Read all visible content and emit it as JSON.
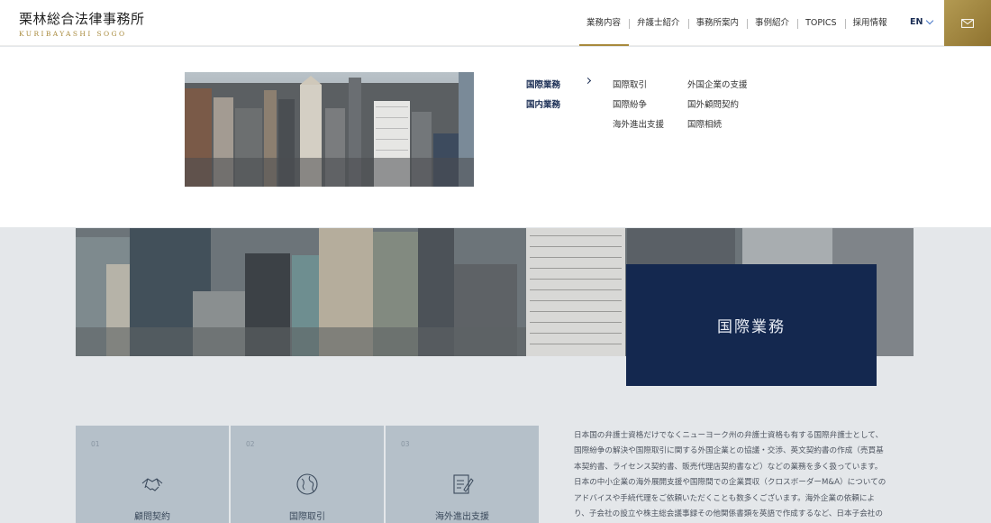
{
  "header": {
    "logo_jp": "栗林総合法律事務所",
    "logo_en": "KURIBAYASHI SOGO",
    "nav": [
      {
        "label": "業務内容"
      },
      {
        "label": "弁護士紹介"
      },
      {
        "label": "事務所案内"
      },
      {
        "label": "事例紹介"
      },
      {
        "label": "TOPICS"
      },
      {
        "label": "採用情報"
      }
    ],
    "lang": "EN",
    "mail_icon": "mail-icon"
  },
  "dropdown": {
    "categories": [
      {
        "label": "国際業務"
      },
      {
        "label": "国内業務"
      }
    ],
    "links": [
      {
        "label": "国際取引"
      },
      {
        "label": "外国企業の支援"
      },
      {
        "label": "国際紛争"
      },
      {
        "label": "国外顧問契約"
      },
      {
        "label": "海外進出支援"
      },
      {
        "label": "国際相続"
      }
    ]
  },
  "hero": {
    "title": "国際業務"
  },
  "cards": [
    {
      "num": "01",
      "label": "顧問契約",
      "icon": "handshake-icon"
    },
    {
      "num": "02",
      "label": "国際取引",
      "icon": "globe-icon"
    },
    {
      "num": "03",
      "label": "海外進出支援",
      "icon": "document-pen-icon"
    }
  ],
  "body_text": [
    "日本国の弁護士資格だけでなくニューヨーク州の弁護士資格も有する国際弁護士として、",
    "国際紛争の解決や国際取引に関する外国企業との協議・交渉、英文契約書の作成（売買基",
    "本契約書、ライセンス契約書、販売代理店契約書など）などの業務を多く扱っています。",
    "日本の中小企業の海外展開支援や国際間での企業買収（クロスボーダーM&A）についての",
    "アドバイスや手続代理をご依頼いただくことも数多くございます。海外企業の依頼によ",
    "り、子会社の設立や株主総会議事録その他関係書類を英語で作成するなど、日本子会社の"
  ],
  "colors": {
    "navy": "#14284f",
    "gold": "#a88a3c"
  }
}
